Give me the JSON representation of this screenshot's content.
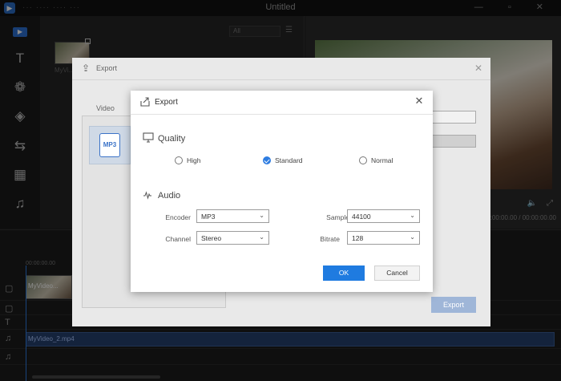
{
  "app": {
    "title": "Untitled",
    "logo_letter": "▶",
    "menu_text": "··· ···· ···· ···",
    "window_controls": "— ▫ ✕"
  },
  "media_panel": {
    "filter_value": "All",
    "thumb_label": "MyVi..."
  },
  "preview": {
    "timecode": "00:00:00.00 / 00:00:00.00"
  },
  "timeline": {
    "ruler_start": "00:00:00.00",
    "video_clip_label": "MyVideo...",
    "audio_clip_label": "MyVideo_2.mp4"
  },
  "background_dialog": {
    "title": "Export",
    "tab_video": "Video",
    "format_label": "MP3",
    "export_button": "Export"
  },
  "export_dialog": {
    "title": "Export",
    "quality": {
      "title": "Quality",
      "options": [
        "High",
        "Standard",
        "Normal"
      ],
      "selected": "Standard"
    },
    "audio": {
      "title": "Audio",
      "encoder_label": "Encoder",
      "encoder_value": "MP3",
      "sample_rate_label": "Sample rate",
      "sample_rate_value": "44100",
      "channel_label": "Channel",
      "channel_value": "Stereo",
      "bitrate_label": "Bitrate",
      "bitrate_value": "128"
    },
    "ok_label": "OK",
    "cancel_label": "Cancel"
  },
  "colors": {
    "accent": "#1f7be0",
    "dialog_bg": "#ffffff",
    "app_bg": "#202020"
  }
}
